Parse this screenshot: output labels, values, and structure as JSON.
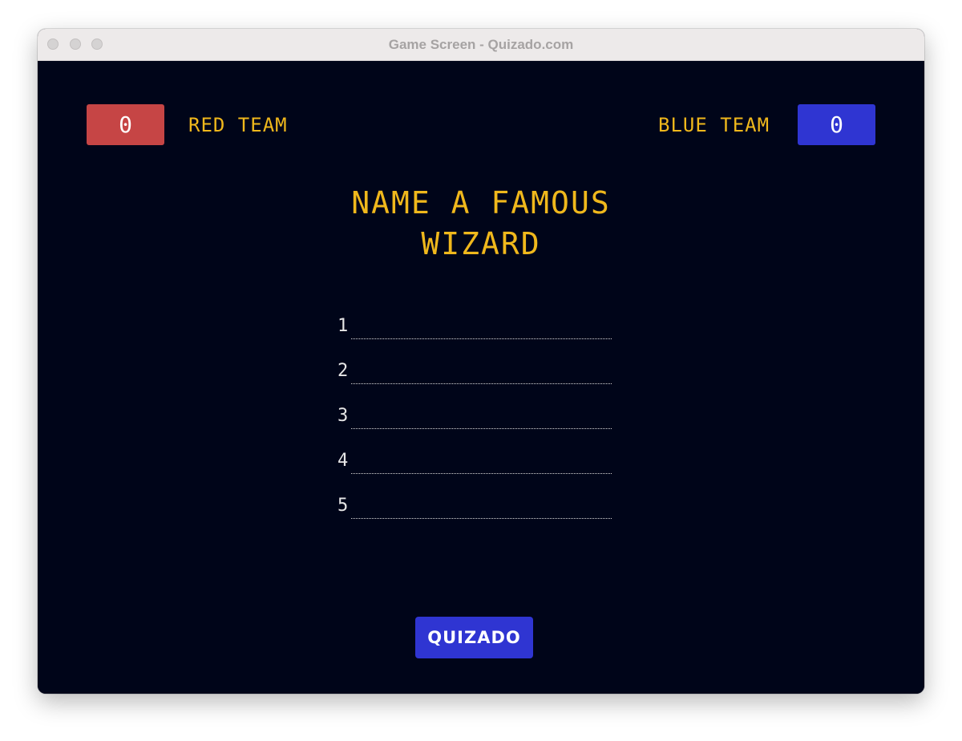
{
  "window": {
    "title": "Game Screen - Quizado.com"
  },
  "teams": {
    "red": {
      "name": "RED TEAM",
      "score": "0",
      "color": "#c64545"
    },
    "blue": {
      "name": "BLUE TEAM",
      "score": "0",
      "color": "#2f35d2"
    }
  },
  "question": {
    "line1": "NAME A FAMOUS",
    "line2": "WIZARD"
  },
  "answers": [
    {
      "number": "1",
      "text": ""
    },
    {
      "number": "2",
      "text": ""
    },
    {
      "number": "3",
      "text": ""
    },
    {
      "number": "4",
      "text": ""
    },
    {
      "number": "5",
      "text": ""
    }
  ],
  "logo": {
    "label": "QUIZADO"
  },
  "colors": {
    "background": "#000519",
    "accent": "#f0b81c"
  }
}
